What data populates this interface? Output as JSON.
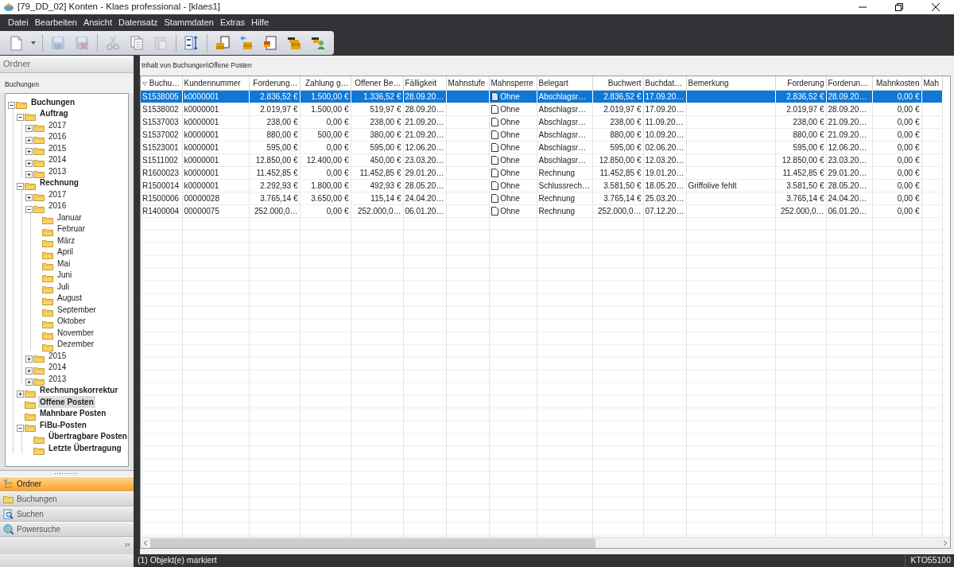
{
  "window": {
    "title": "[79_DD_02] Konten - Klaes professional - [klaes1]"
  },
  "menu": [
    "Datei",
    "Bearbeiten",
    "Ansicht",
    "Datensatz",
    "Stammdaten",
    "Extras",
    "Hilfe"
  ],
  "toolbar": [
    {
      "kind": "new",
      "disabled": false
    },
    {
      "kind": "dropdown",
      "disabled": false
    },
    {
      "kind": "sep"
    },
    {
      "kind": "save",
      "disabled": true
    },
    {
      "kind": "save-delete",
      "disabled": true
    },
    {
      "kind": "sep"
    },
    {
      "kind": "cut",
      "disabled": true
    },
    {
      "kind": "copy",
      "disabled": false
    },
    {
      "kind": "paste",
      "disabled": true
    },
    {
      "kind": "sep"
    },
    {
      "kind": "sort",
      "disabled": false
    },
    {
      "kind": "sep"
    },
    {
      "kind": "coin-doc",
      "disabled": false
    },
    {
      "kind": "coin-arrow",
      "disabled": false
    },
    {
      "kind": "doc-export",
      "disabled": false
    },
    {
      "kind": "coins",
      "disabled": false
    },
    {
      "kind": "coin-person",
      "disabled": false
    }
  ],
  "sidebar": {
    "header": "Ordner",
    "subtitle": "Buchungen",
    "tree": [
      {
        "label": "Buchungen",
        "bold": true,
        "selected": false,
        "expanded": true,
        "children": [
          {
            "label": "Auftrag",
            "bold": true,
            "selected": false,
            "expanded": true,
            "children": [
              {
                "label": "2017",
                "bold": false,
                "selected": false,
                "expanded": false
              },
              {
                "label": "2016",
                "bold": false,
                "selected": false,
                "expanded": false
              },
              {
                "label": "2015",
                "bold": false,
                "selected": false,
                "expanded": false
              },
              {
                "label": "2014",
                "bold": false,
                "selected": false,
                "expanded": false
              },
              {
                "label": "2013",
                "bold": false,
                "selected": false,
                "expanded": false
              }
            ]
          },
          {
            "label": "Rechnung",
            "bold": true,
            "selected": false,
            "expanded": true,
            "children": [
              {
                "label": "2017",
                "bold": false,
                "selected": false,
                "expanded": false
              },
              {
                "label": "2016",
                "bold": false,
                "selected": false,
                "expanded": true,
                "children": [
                  {
                    "label": "Januar",
                    "bold": false,
                    "selected": false
                  },
                  {
                    "label": "Februar",
                    "bold": false,
                    "selected": false
                  },
                  {
                    "label": "März",
                    "bold": false,
                    "selected": false
                  },
                  {
                    "label": "April",
                    "bold": false,
                    "selected": false
                  },
                  {
                    "label": "Mai",
                    "bold": false,
                    "selected": false
                  },
                  {
                    "label": "Juni",
                    "bold": false,
                    "selected": false
                  },
                  {
                    "label": "Juli",
                    "bold": false,
                    "selected": false
                  },
                  {
                    "label": "August",
                    "bold": false,
                    "selected": false
                  },
                  {
                    "label": "September",
                    "bold": false,
                    "selected": false
                  },
                  {
                    "label": "Oktober",
                    "bold": false,
                    "selected": false
                  },
                  {
                    "label": "November",
                    "bold": false,
                    "selected": false
                  },
                  {
                    "label": "Dezember",
                    "bold": false,
                    "selected": false
                  }
                ]
              },
              {
                "label": "2015",
                "bold": false,
                "selected": false,
                "expanded": false
              },
              {
                "label": "2014",
                "bold": false,
                "selected": false,
                "expanded": false
              },
              {
                "label": "2013",
                "bold": false,
                "selected": false,
                "expanded": false
              }
            ]
          },
          {
            "label": "Rechnungskorrektur",
            "bold": true,
            "selected": false,
            "expanded": false
          },
          {
            "label": "Offene Posten",
            "bold": true,
            "selected": true
          },
          {
            "label": "Mahnbare Posten",
            "bold": true,
            "selected": false
          },
          {
            "label": "FiBu-Posten",
            "bold": true,
            "selected": false,
            "expanded": true,
            "children": [
              {
                "label": "Übertragbare Posten",
                "bold": true,
                "selected": false
              },
              {
                "label": "Letzte Übertragung",
                "bold": true,
                "selected": false
              }
            ]
          }
        ]
      }
    ],
    "nav": [
      {
        "label": "Ordner",
        "kind": "tree",
        "selected": true
      },
      {
        "label": "Buchungen",
        "kind": "folder",
        "selected": false
      },
      {
        "label": "Suchen",
        "kind": "search",
        "selected": false
      },
      {
        "label": "Powersuche",
        "kind": "power-search",
        "selected": false
      }
    ]
  },
  "content": {
    "path": "Inhalt von Buchungen\\Offene Posten",
    "table": {
      "columns": [
        {
          "label": "Buchu…",
          "kind": "text",
          "sorted": true
        },
        {
          "label": "Kundennummer",
          "kind": "text",
          "sorted": false
        },
        {
          "label": "Forderung…",
          "kind": "amount",
          "sorted": false
        },
        {
          "label": "Zahlung g…",
          "kind": "amount",
          "sorted": false
        },
        {
          "label": "Offener Be…",
          "kind": "amount",
          "sorted": false
        },
        {
          "label": "Fälligkeit",
          "kind": "text",
          "sorted": false
        },
        {
          "label": "Mahnstufe",
          "kind": "text",
          "sorted": false
        },
        {
          "label": "Mahnsperre",
          "kind": "flag",
          "sorted": false
        },
        {
          "label": "Belegart",
          "kind": "text",
          "sorted": false
        },
        {
          "label": "Buchwert",
          "kind": "amount",
          "sorted": false
        },
        {
          "label": "Buchdat…",
          "kind": "text",
          "sorted": false
        },
        {
          "label": "Bemerkung",
          "kind": "text",
          "sorted": false
        },
        {
          "label": "Forderung",
          "kind": "amount",
          "sorted": false
        },
        {
          "label": "Forderun…",
          "kind": "text",
          "sorted": false
        },
        {
          "label": "Mahnkosten",
          "kind": "amount",
          "sorted": false
        },
        {
          "label": "Mah",
          "kind": "text",
          "sorted": false
        }
      ],
      "rows": [
        {
          "selected": true,
          "cells": [
            "S1538005",
            "k0000001",
            "2.836,52 €",
            "1.500,00 €",
            "1.336,52 €",
            "28.09.20…",
            null,
            "Ohne",
            "Abschlagsr…",
            "2.836,52 €",
            "17.09.20…",
            null,
            "2.836,52 €",
            "28.09.20…",
            "0,00 €",
            null
          ]
        },
        {
          "selected": false,
          "cells": [
            "S1538002",
            "k0000001",
            "2.019,97 €",
            "1.500,00 €",
            "519,97 €",
            "28.09.20…",
            null,
            "Ohne",
            "Abschlagsr…",
            "2.019,97 €",
            "17.09.20…",
            null,
            "2.019,97 €",
            "28.09.20…",
            "0,00 €",
            null
          ]
        },
        {
          "selected": false,
          "cells": [
            "S1537003",
            "k0000001",
            "238,00 €",
            "0,00 €",
            "238,00 €",
            "21.09.20…",
            null,
            "Ohne",
            "Abschlagsr…",
            "238,00 €",
            "11.09.20…",
            null,
            "238,00 €",
            "21.09.20…",
            "0,00 €",
            null
          ]
        },
        {
          "selected": false,
          "cells": [
            "S1537002",
            "k0000001",
            "880,00 €",
            "500,00 €",
            "380,00 €",
            "21.09.20…",
            null,
            "Ohne",
            "Abschlagsr…",
            "880,00 €",
            "10.09.20…",
            null,
            "880,00 €",
            "21.09.20…",
            "0,00 €",
            null
          ]
        },
        {
          "selected": false,
          "cells": [
            "S1523001",
            "k0000001",
            "595,00 €",
            "0,00 €",
            "595,00 €",
            "12.06.20…",
            null,
            "Ohne",
            "Abschlagsr…",
            "595,00 €",
            "02.06.20…",
            null,
            "595,00 €",
            "12.06.20…",
            "0,00 €",
            null
          ]
        },
        {
          "selected": false,
          "cells": [
            "S1511002",
            "k0000001",
            "12.850,00 €",
            "12.400,00 €",
            "450,00 €",
            "23.03.20…",
            null,
            "Ohne",
            "Abschlagsr…",
            "12.850,00 €",
            "12.03.20…",
            null,
            "12.850,00 €",
            "23.03.20…",
            "0,00 €",
            null
          ]
        },
        {
          "selected": false,
          "cells": [
            "R1600023",
            "k0000001",
            "11.452,85 €",
            "0,00 €",
            "11.452,85 €",
            "29.01.20…",
            null,
            "Ohne",
            "Rechnung",
            "11.452,85 €",
            "19.01.20…",
            null,
            "11.452,85 €",
            "29.01.20…",
            "0,00 €",
            null
          ]
        },
        {
          "selected": false,
          "cells": [
            "R1500014",
            "k0000001",
            "2.292,93 €",
            "1.800,00 €",
            "492,93 €",
            "28.05.20…",
            null,
            "Ohne",
            "Schlussrech…",
            "3.581,50 €",
            "18.05.20…",
            "Griffolive fehlt",
            "3.581,50 €",
            "28.05.20…",
            "0,00 €",
            null
          ]
        },
        {
          "selected": false,
          "cells": [
            "R1500006",
            "00000028",
            "3.765,14 €",
            "3.650,00 €",
            "115,14 €",
            "24.04.20…",
            null,
            "Ohne",
            "Rechnung",
            "3.765,14 €",
            "25.03.20…",
            null,
            "3.765,14 €",
            "24.04.20…",
            "0,00 €",
            null
          ]
        },
        {
          "selected": false,
          "cells": [
            "R1400004",
            "00000075",
            "252.000,0…",
            "0,00 €",
            "252.000,0…",
            "06.01.20…",
            null,
            "Ohne",
            "Rechnung",
            "252.000,0…",
            "07.12.20…",
            null,
            "252.000,0…",
            "06.01.20…",
            "0,00 €",
            null
          ]
        }
      ]
    }
  },
  "status_bar": {
    "message": "(1) Objekt(e) markiert",
    "code": "KTO55100"
  }
}
